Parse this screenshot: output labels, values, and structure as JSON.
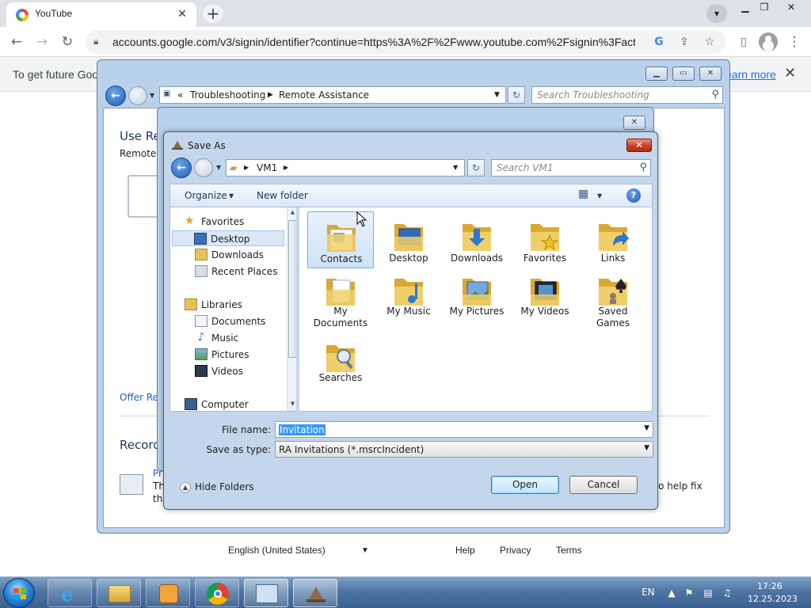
{
  "browser": {
    "tab_title": "YouTube",
    "url": "accounts.google.com/v3/signin/identifier?continue=https%3A%2F%2Fwww.youtube.com%2Fsignin%3Facti...",
    "infobar_text": "To get future Goog",
    "infobar_link": "earn more",
    "footer": {
      "language": "English (United States)",
      "help": "Help",
      "privacy": "Privacy",
      "terms": "Terms"
    }
  },
  "explorer": {
    "breadcrumb": [
      "Troubleshooting",
      "Remote Assistance"
    ],
    "search_placeholder": "Search Troubleshooting",
    "heading": "Use Re",
    "subtext": "Remote A",
    "offer_link": "Offer Re",
    "record_heading": "Record",
    "step_line1": "Pr",
    "step_line2": "Th",
    "step_line3": "the",
    "help_fix": "d to help fix"
  },
  "saveas": {
    "title": "Save As",
    "breadcrumb": "VM1",
    "search_placeholder": "Search VM1",
    "organize": "Organize",
    "new_folder": "New folder",
    "nav": {
      "favorites": "Favorites",
      "desktop": "Desktop",
      "downloads": "Downloads",
      "recent": "Recent Places",
      "libraries": "Libraries",
      "documents": "Documents",
      "music": "Music",
      "pictures": "Pictures",
      "videos": "Videos",
      "computer": "Computer"
    },
    "items": {
      "contacts": "Contacts",
      "desktop": "Desktop",
      "downloads": "Downloads",
      "favorites": "Favorites",
      "links": "Links",
      "my_documents_1": "My",
      "my_documents_2": "Documents",
      "my_music": "My Music",
      "my_pictures": "My Pictures",
      "my_videos": "My Videos",
      "saved_games_1": "Saved",
      "saved_games_2": "Games",
      "searches": "Searches"
    },
    "file_name_label": "File name:",
    "file_name_value": "Invitation",
    "save_type_label": "Save as type:",
    "save_type_value": "RA Invitations (*.msrcIncident)",
    "hide_folders": "Hide Folders",
    "open_button": "Open",
    "cancel_button": "Cancel"
  },
  "taskbar": {
    "language": "EN",
    "time": "17:26",
    "date": "12.25.2023"
  },
  "colors": {
    "accent": "#1a73e8",
    "selection": "#3399ff",
    "close_red": "#c8412a",
    "aero_frame": "#c3d6ec"
  }
}
